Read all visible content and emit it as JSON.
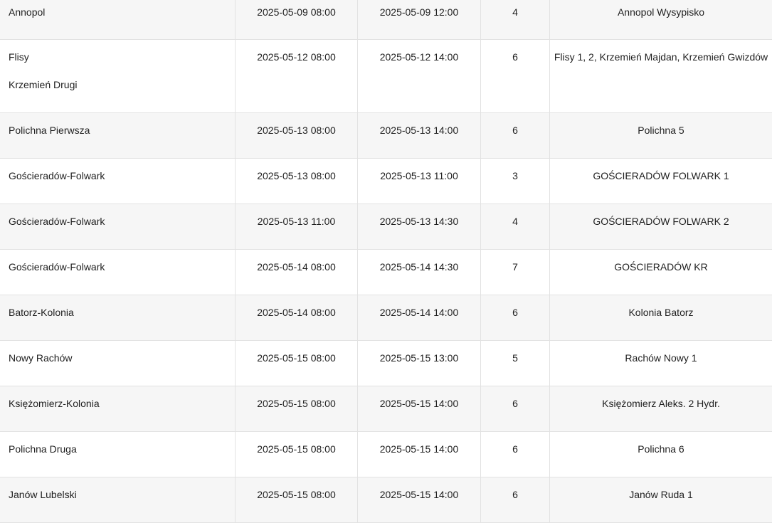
{
  "table": {
    "rows": [
      {
        "locations": [
          "Annopol"
        ],
        "start": "2025-05-09 08:00",
        "end": "2025-05-09 12:00",
        "hours": "4",
        "station": "Annopol Wysypisko"
      },
      {
        "locations": [
          "Flisy",
          "Krzemień Drugi"
        ],
        "start": "2025-05-12 08:00",
        "end": "2025-05-12 14:00",
        "hours": "6",
        "station": "Flisy 1, 2, Krzemień Majdan, Krzemień Gwizdów"
      },
      {
        "locations": [
          "Polichna Pierwsza"
        ],
        "start": "2025-05-13 08:00",
        "end": "2025-05-13 14:00",
        "hours": "6",
        "station": "Polichna 5"
      },
      {
        "locations": [
          "Gościeradów-Folwark"
        ],
        "start": "2025-05-13 08:00",
        "end": "2025-05-13 11:00",
        "hours": "3",
        "station": "GOŚCIERADÓW FOLWARK 1"
      },
      {
        "locations": [
          "Gościeradów-Folwark"
        ],
        "start": "2025-05-13 11:00",
        "end": "2025-05-13 14:30",
        "hours": "4",
        "station": "GOŚCIERADÓW FOLWARK 2"
      },
      {
        "locations": [
          "Gościeradów-Folwark"
        ],
        "start": "2025-05-14 08:00",
        "end": "2025-05-14 14:30",
        "hours": "7",
        "station": "GOŚCIERADÓW KR"
      },
      {
        "locations": [
          "Batorz-Kolonia"
        ],
        "start": "2025-05-14 08:00",
        "end": "2025-05-14 14:00",
        "hours": "6",
        "station": "Kolonia Batorz"
      },
      {
        "locations": [
          "Nowy Rachów"
        ],
        "start": "2025-05-15 08:00",
        "end": "2025-05-15 13:00",
        "hours": "5",
        "station": "Rachów Nowy 1"
      },
      {
        "locations": [
          "Księżomierz-Kolonia"
        ],
        "start": "2025-05-15 08:00",
        "end": "2025-05-15 14:00",
        "hours": "6",
        "station": "Księżomierz Aleks. 2 Hydr."
      },
      {
        "locations": [
          "Polichna Druga"
        ],
        "start": "2025-05-15 08:00",
        "end": "2025-05-15 14:00",
        "hours": "6",
        "station": "Polichna 6"
      },
      {
        "locations": [
          "Janów Lubelski"
        ],
        "start": "2025-05-15 08:00",
        "end": "2025-05-15 14:00",
        "hours": "6",
        "station": "Janów Ruda 1"
      }
    ]
  }
}
